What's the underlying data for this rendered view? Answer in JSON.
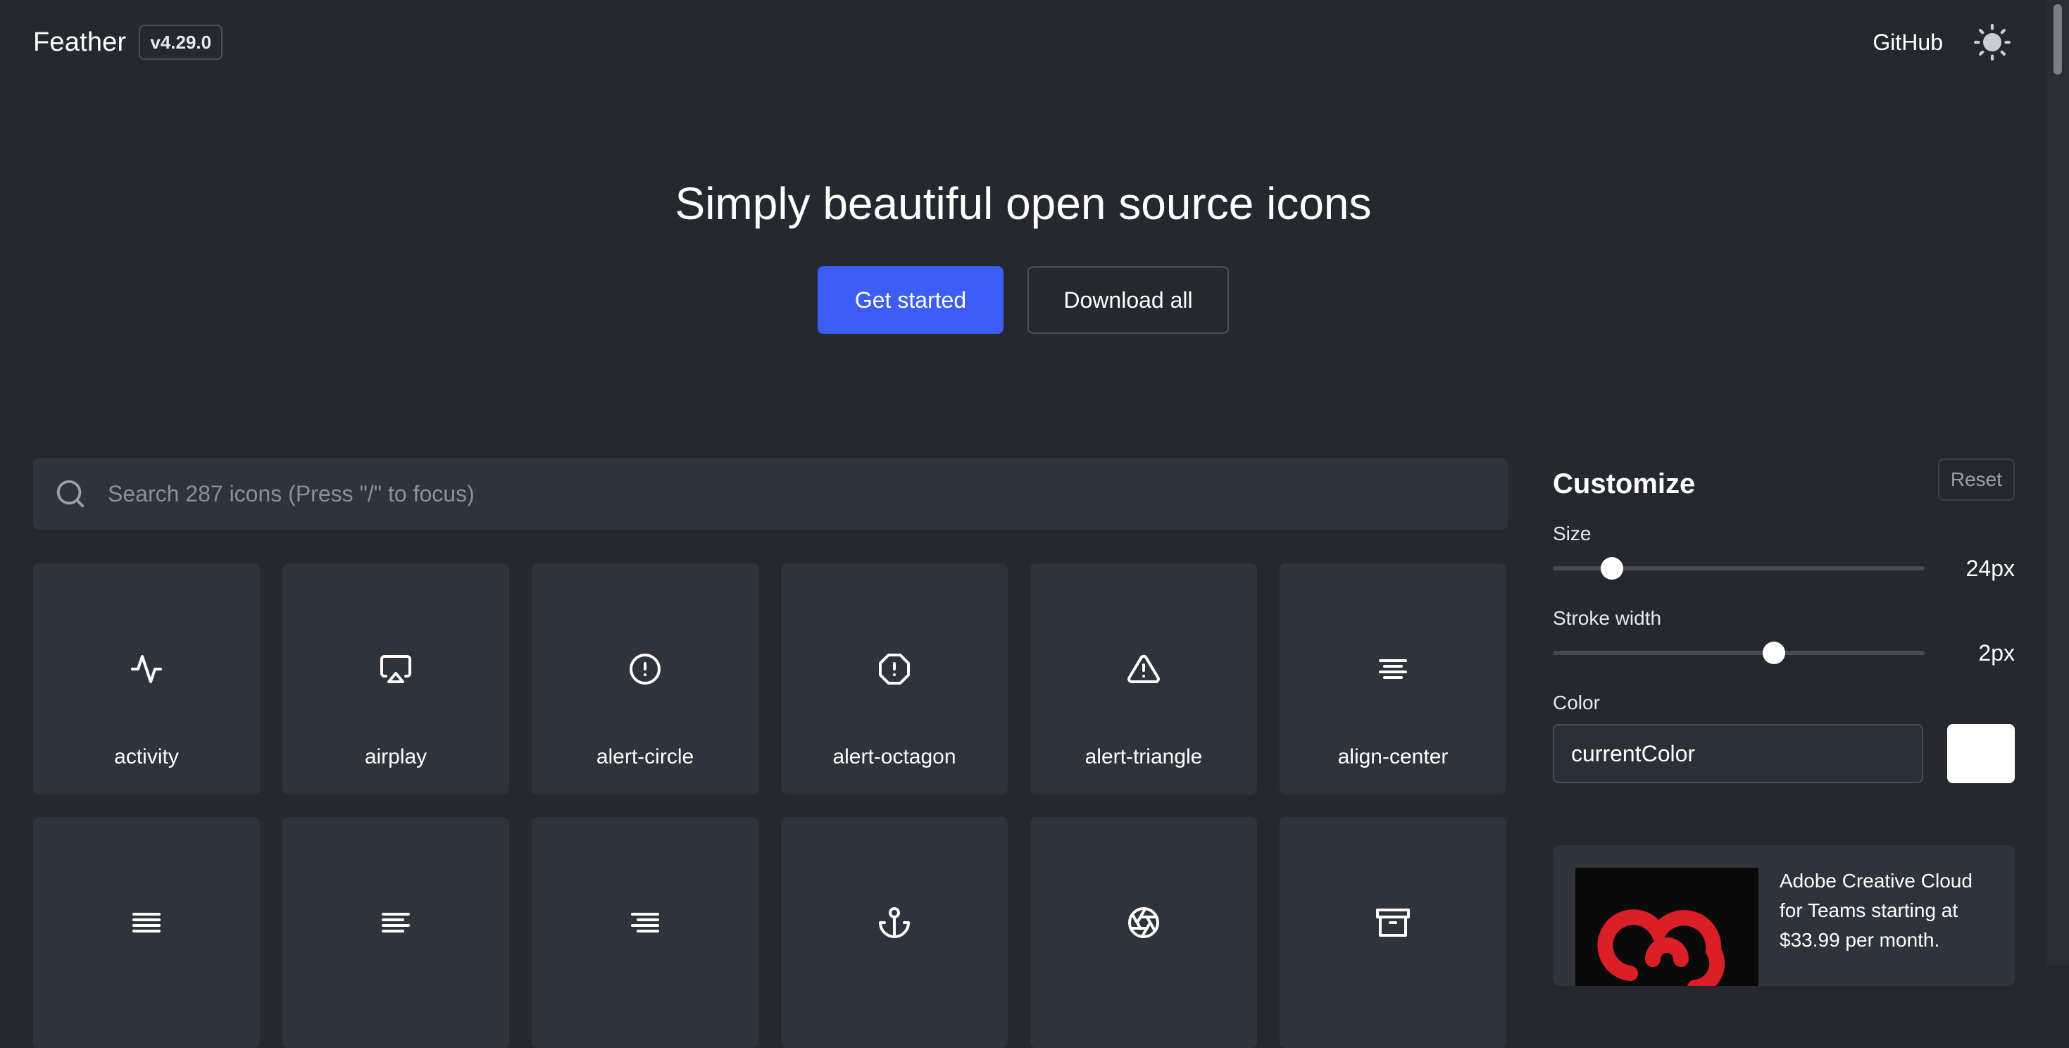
{
  "header": {
    "brand": "Feather",
    "version": "v4.29.0",
    "github": "GitHub",
    "theme_icon": "sun-icon"
  },
  "hero": {
    "title": "Simply beautiful open source icons",
    "primary_button": "Get started",
    "secondary_button": "Download all"
  },
  "search": {
    "placeholder": "Search 287 icons (Press \"/\" to focus)",
    "icon": "search-icon"
  },
  "icons": [
    {
      "label": "activity",
      "icon": "activity-icon"
    },
    {
      "label": "airplay",
      "icon": "airplay-icon"
    },
    {
      "label": "alert-circle",
      "icon": "alert-circle-icon"
    },
    {
      "label": "alert-octagon",
      "icon": "alert-octagon-icon"
    },
    {
      "label": "alert-triangle",
      "icon": "alert-triangle-icon"
    },
    {
      "label": "align-center",
      "icon": "align-center-icon"
    },
    {
      "label": "",
      "icon": "align-justify-icon"
    },
    {
      "label": "",
      "icon": "align-left-icon"
    },
    {
      "label": "",
      "icon": "align-right-icon"
    },
    {
      "label": "",
      "icon": "anchor-icon"
    },
    {
      "label": "",
      "icon": "aperture-icon"
    },
    {
      "label": "",
      "icon": "archive-icon"
    }
  ],
  "customize": {
    "title": "Customize",
    "reset": "Reset",
    "size": {
      "label": "Size",
      "value": "24px",
      "level": 0.16
    },
    "stroke_width": {
      "label": "Stroke width",
      "value": "2px",
      "level": 0.595
    },
    "color": {
      "label": "Color",
      "value": "currentColor",
      "swatch": "#ffffff"
    }
  },
  "ad": {
    "text": "Adobe Creative Cloud for Teams starting at $33.99 per month.",
    "logo_color": "#da1f26"
  },
  "colors": {
    "background": "#25282e",
    "tile": "#2f333b",
    "accent": "#3c5df6"
  }
}
